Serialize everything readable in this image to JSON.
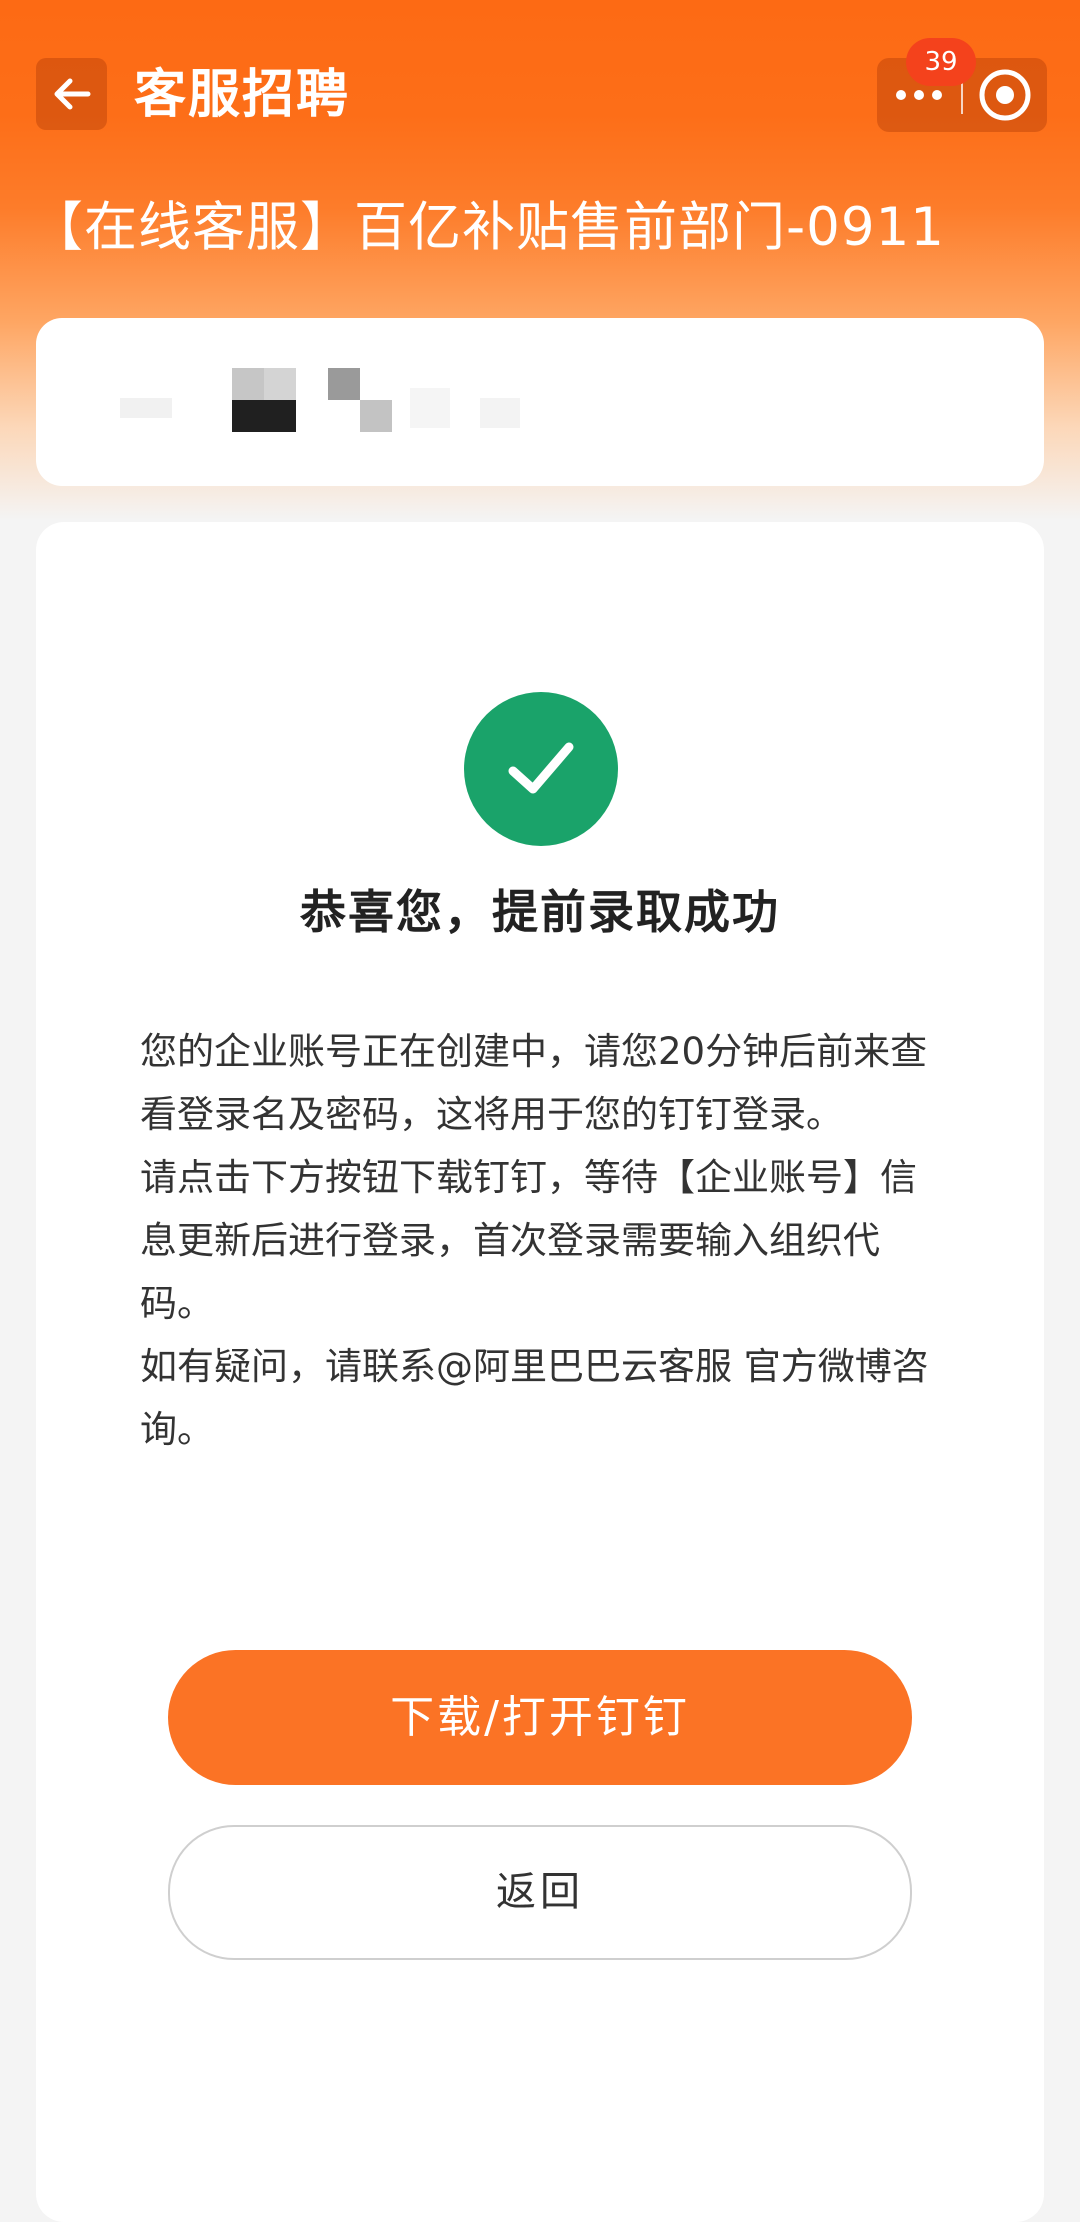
{
  "app": {
    "title": "客服招聘",
    "badge_count": "39",
    "accent_color": "#fb7325",
    "success_color": "#1aa36a"
  },
  "header": {
    "job_title": "【在线客服】百亿补贴售前部门-0911"
  },
  "icons": {
    "back": "arrow-left-icon",
    "more": "more-dots-icon",
    "close": "target-circle-icon",
    "success": "checkmark-circle-icon"
  },
  "result": {
    "title": "恭喜您，提前录取成功",
    "message_lines": [
      "您的企业账号正在创建中，请您20分钟后前来查看登录名及密码，这将用于您的钉钉登录。",
      "请点击下方按钮下载钉钉，等待【企业账号】信息更新后进行登录，首次登录需要输入组织代码。",
      "如有疑问，请联系@阿里巴巴云客服 官方微博咨询。"
    ]
  },
  "actions": {
    "primary_label": "下载/打开钉钉",
    "secondary_label": "返回"
  }
}
